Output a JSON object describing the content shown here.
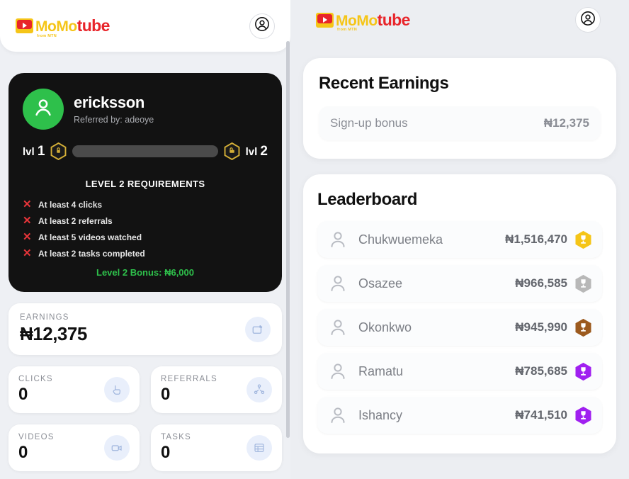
{
  "brand": {
    "name_momo": "MoMo",
    "name_tube": "tube",
    "from": "from MTN",
    "color_yellow": "#F5C518",
    "color_red": "#E8242A"
  },
  "left": {
    "header": {
      "account_icon": "account-circle-icon"
    },
    "profile": {
      "username": "ericksson",
      "referred_by": "Referred by: adeoye",
      "avatar_icon": "person-icon",
      "avatar_color": "#2EC04B",
      "level_from_label": "lvl",
      "level_from": "1",
      "level_to_label": "lvl",
      "level_to": "2",
      "progress_percent": 0,
      "badge_icon": "hex-lock-icon",
      "badge_color": "#D4AF37"
    },
    "requirements": {
      "title": "LEVEL 2 REQUIREMENTS",
      "items": [
        {
          "status_icon": "cross-icon",
          "text": "At least 4 clicks"
        },
        {
          "status_icon": "cross-icon",
          "text": "At least 2 referrals"
        },
        {
          "status_icon": "cross-icon",
          "text": "At least 5 videos watched"
        },
        {
          "status_icon": "cross-icon",
          "text": "At least 2 tasks completed"
        }
      ],
      "bonus": "Level 2 Bonus: ₦6,000",
      "bonus_color": "#2EC04B"
    },
    "stats": {
      "earnings": {
        "label": "EARNINGS",
        "value": "₦12,375",
        "icon": "wallet-icon"
      },
      "clicks": {
        "label": "CLICKS",
        "value": "0",
        "icon": "cursor-click-icon"
      },
      "referrals": {
        "label": "REFERRALS",
        "value": "0",
        "icon": "share-network-icon"
      },
      "videos": {
        "label": "VIDEOS",
        "value": "0",
        "icon": "video-camera-icon"
      },
      "tasks": {
        "label": "TASKS",
        "value": "0",
        "icon": "table-list-icon"
      }
    }
  },
  "right": {
    "header": {
      "account_icon": "account-circle-icon"
    },
    "recent_earnings": {
      "title": "Recent Earnings",
      "rows": [
        {
          "label": "Sign-up bonus",
          "amount": "₦12,375"
        }
      ]
    },
    "leaderboard": {
      "title": "Leaderboard",
      "rows": [
        {
          "rank": 1,
          "name": "Chukwuemeka",
          "amount": "₦1,516,470",
          "badge_color": "#F5C518",
          "badge_icon": "trophy-hex-icon"
        },
        {
          "rank": 2,
          "name": "Osazee",
          "amount": "₦966,585",
          "badge_color": "#B8B8B8",
          "badge_icon": "trophy-hex-icon"
        },
        {
          "rank": 3,
          "name": "Okonkwo",
          "amount": "₦945,990",
          "badge_color": "#9C5A1E",
          "badge_icon": "trophy-hex-icon"
        },
        {
          "rank": 4,
          "name": "Ramatu",
          "amount": "₦785,685",
          "badge_color": "#A020F0",
          "badge_icon": "trophy-hex-icon"
        },
        {
          "rank": 5,
          "name": "Ishancy",
          "amount": "₦741,510",
          "badge_color": "#A020F0",
          "badge_icon": "trophy-hex-icon"
        }
      ]
    }
  }
}
